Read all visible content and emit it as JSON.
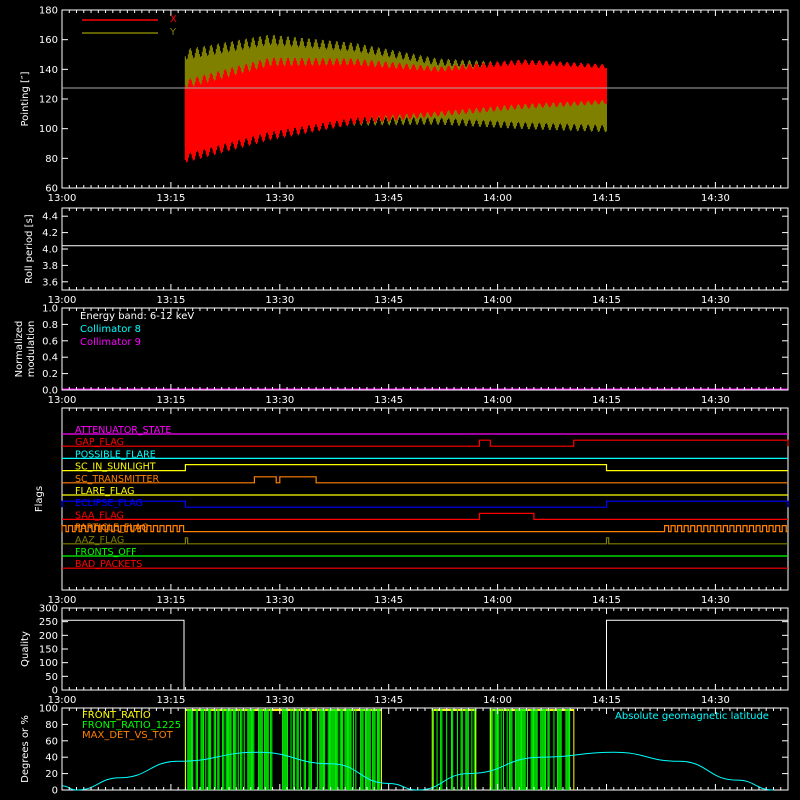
{
  "time_ticks": [
    "13:00",
    "13:15",
    "13:30",
    "13:45",
    "14:00",
    "14:15",
    "14:30"
  ],
  "chart_data": [
    {
      "type": "line",
      "ylabel": "Pointing [″]",
      "ylim": [
        60,
        180
      ],
      "yticks": [
        "60",
        "80",
        "100",
        "120",
        "140",
        "160",
        "180"
      ],
      "legend": [
        {
          "name": "X",
          "color": "#ff0000"
        },
        {
          "name": "Y",
          "color": "#808000"
        }
      ],
      "reference_line": 128,
      "data_window": [
        "13:17",
        "14:15"
      ],
      "series": [
        {
          "name": "X",
          "color": "#ff0000",
          "approx_center": [
            105,
            120,
            125,
            125,
            130,
            130
          ],
          "approx_amplitude": [
            25,
            25,
            20,
            15,
            15,
            12
          ]
        },
        {
          "name": "Y",
          "color": "#808000",
          "approx_center": [
            120,
            130,
            130,
            125,
            122,
            120
          ],
          "approx_amplitude": [
            30,
            30,
            25,
            20,
            20,
            20
          ]
        }
      ]
    },
    {
      "type": "line",
      "ylabel": "Roll period [s]",
      "ylim": [
        3.5,
        4.5
      ],
      "yticks": [
        "3.6",
        "3.8",
        "4.0",
        "4.2",
        "4.4"
      ],
      "value": 4.04,
      "color": "#ffffff"
    },
    {
      "type": "line",
      "ylabel_lines": [
        "Normalized",
        "modulation"
      ],
      "ylim": [
        0,
        1
      ],
      "yticks": [
        "0.0",
        "0.2",
        "0.4",
        "0.6",
        "0.8",
        "1.0"
      ],
      "annotations": [
        {
          "text": "Energy band: 6-12 keV",
          "color": "#ffffff"
        },
        {
          "text": "Collimator 8",
          "color": "#00ffff"
        },
        {
          "text": "Collimator 9",
          "color": "#ff00ff"
        }
      ],
      "value": 0,
      "color": "#ff00ff"
    },
    {
      "type": "line",
      "ylabel": "Flags",
      "flags": [
        {
          "name": "ATTENUATOR_STATE",
          "color": "#ff00ff",
          "high": []
        },
        {
          "name": "GAP_FLAG",
          "color": "#ff0000",
          "high": [
            [
              "13:57.5",
              "13:59.0"
            ],
            [
              "14:10.5",
              "14:40.0"
            ]
          ]
        },
        {
          "name": "POSSIBLE_FLARE",
          "color": "#00ffff",
          "high": []
        },
        {
          "name": "SC_IN_SUNLIGHT",
          "color": "#ffff00",
          "high": [
            [
              "13:17.0",
              "14:15.0"
            ]
          ]
        },
        {
          "name": "SC_TRANSMITTER",
          "color": "#ff8000",
          "high": [
            [
              "13:26.5",
              "13:29.5"
            ],
            [
              "13:30.0",
              "13:35.0"
            ]
          ]
        },
        {
          "name": "FLARE_FLAG",
          "color": "#ffff00",
          "high": []
        },
        {
          "name": "ECLIPSE_FLAG",
          "color": "#0000ff",
          "high": [
            [
              "13:00.0",
              "13:17.0"
            ],
            [
              "14:15.0",
              "14:40.0"
            ]
          ]
        },
        {
          "name": "SAA_FLAG",
          "color": "#ff0000",
          "high": [
            [
              "13:57.5",
              "14:05.0"
            ]
          ]
        },
        {
          "name": "PARTICLE_FLAG",
          "color": "#ff8000",
          "high": [
            [
              "13:00.0",
              "13:17.0"
            ],
            [
              "14:23.0",
              "14:40.0"
            ]
          ]
        },
        {
          "name": "AAZ_FLAG",
          "color": "#808000",
          "high": [
            [
              "13:17.0",
              "13:17.3"
            ],
            [
              "14:15.0",
              "14:15.3"
            ]
          ]
        },
        {
          "name": "FRONTS_OFF",
          "color": "#00ff00",
          "high": []
        },
        {
          "name": "BAD_PACKETS",
          "color": "#ff0000",
          "high": []
        }
      ]
    },
    {
      "type": "line",
      "ylabel": "Quality",
      "ylim": [
        0,
        300
      ],
      "yticks": [
        "0",
        "50",
        "100",
        "150",
        "200",
        "250",
        "300"
      ],
      "color": "#ffffff",
      "x": [
        "13:00",
        "13:16.8",
        "13:16.8",
        "14:15",
        "14:15",
        "14:40"
      ],
      "y": [
        255,
        255,
        0,
        0,
        255,
        255
      ]
    },
    {
      "type": "line",
      "ylabel": "Degrees or %",
      "ylim": [
        0,
        100
      ],
      "yticks": [
        "0",
        "20",
        "40",
        "60",
        "80",
        "100"
      ],
      "legend": [
        {
          "name": "FRONT_RATIO",
          "color": "#ffff00"
        },
        {
          "name": "FRONT_RATIO_1225",
          "color": "#00ff00"
        },
        {
          "name": "MAX_DET_VS_TOT",
          "color": "#ff8000"
        }
      ],
      "annotation": {
        "text": "Absolute geomagnetic latitude",
        "color": "#00ffff"
      },
      "series": [
        {
          "name": "Absolute geomagnetic latitude",
          "color": "#00ffff",
          "x": [
            "13:00",
            "13:02",
            "13:08",
            "13:16",
            "13:27",
            "13:37",
            "13:45",
            "13:49",
            "13:56",
            "14:06",
            "14:16",
            "14:25",
            "14:33",
            "14:38"
          ],
          "y": [
            5,
            0,
            15,
            35,
            46,
            32,
            8,
            0,
            20,
            40,
            46,
            35,
            12,
            0
          ]
        }
      ],
      "green_bars_windows": [
        [
          "13:17",
          "13:44"
        ],
        [
          "13:51",
          "13:57"
        ],
        [
          "13:59",
          "14:10.5"
        ]
      ]
    }
  ]
}
